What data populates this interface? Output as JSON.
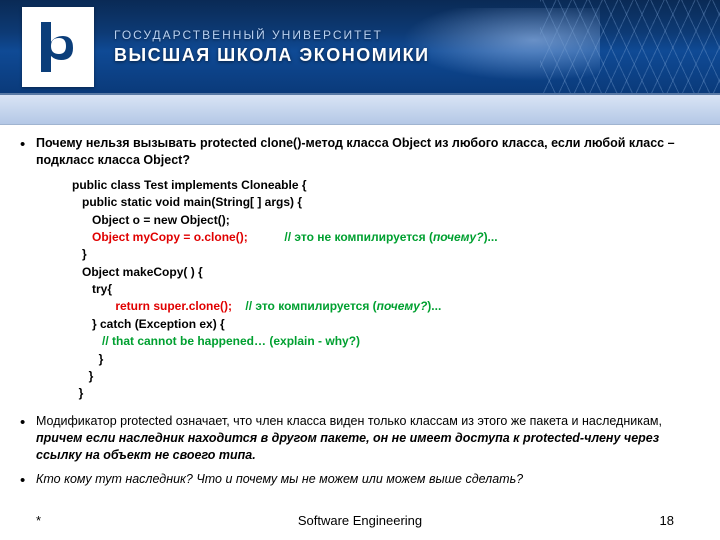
{
  "header": {
    "subtitle": "ГОСУДАРСТВЕННЫЙ УНИВЕРСИТЕТ",
    "title": "ВЫСШАЯ ШКОЛА ЭКОНОМИКИ",
    "logo_name": "hse-logo"
  },
  "bullets": {
    "q1a": "Почему нельзя вызывать protected clone()-метод класса Object из любого класса, если любой класс – подкласс класса Object?",
    "q2a": "Модификатор protected означает, что член класса виден только классам из этого же пакета и наследникам, ",
    "q2b": "причем если наследник находится в другом пакете, он не имеет доступа к protected-члену через ссылку на объект не своего типа.",
    "q3": "Кто кому тут наследник? Что и почему мы не можем или можем выше сделать?"
  },
  "code": {
    "l1": "public class Test implements Cloneable {",
    "l2": "   public static void main(String[ ] args) {",
    "l3": "      Object o = new Object();",
    "l4r": "      Object myCopy = o.clone();",
    "l4g": "           // это не компилируется (",
    "l4gi": "почему?",
    "l4g2": ")...",
    "l5": "   }",
    "l6": "   Object makeCopy( ) {",
    "l7": "      try{",
    "l8r": "             return super.clone();",
    "l8g": "    // это компилируется (",
    "l8gi": "почему?",
    "l8g2": ")...",
    "l9": "      } catch (Exception ex) {",
    "l10g": "         // that cannot be happened… (explain - why?)",
    "l11": "        }",
    "l12": "     }",
    "l13": "  }"
  },
  "footer": {
    "left": "*",
    "center": "Software Engineering",
    "page": "18"
  }
}
